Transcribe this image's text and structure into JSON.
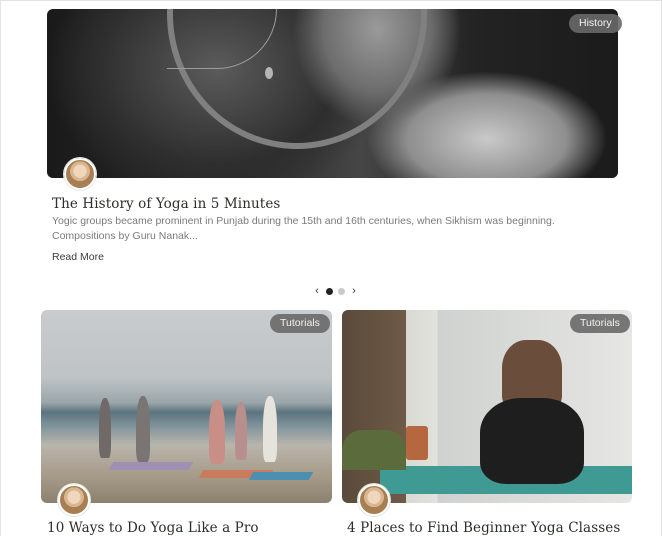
{
  "featured": {
    "category": "History",
    "title": "The History of Yoga in 5 Minutes",
    "excerpt": "Yogic groups became prominent in Punjab during the 15th and 16th centuries, when Sikhism was beginning. Compositions by Guru Nanak...",
    "read_more": "Read More"
  },
  "pager": {
    "prev_icon": "‹",
    "next_icon": "›",
    "active_index": 0,
    "count": 2
  },
  "cards": [
    {
      "category": "Tutorials",
      "title": "10 Ways to Do Yoga Like a Pro"
    },
    {
      "category": "Tutorials",
      "title": "4 Places to Find Beginner Yoga Classes"
    }
  ]
}
